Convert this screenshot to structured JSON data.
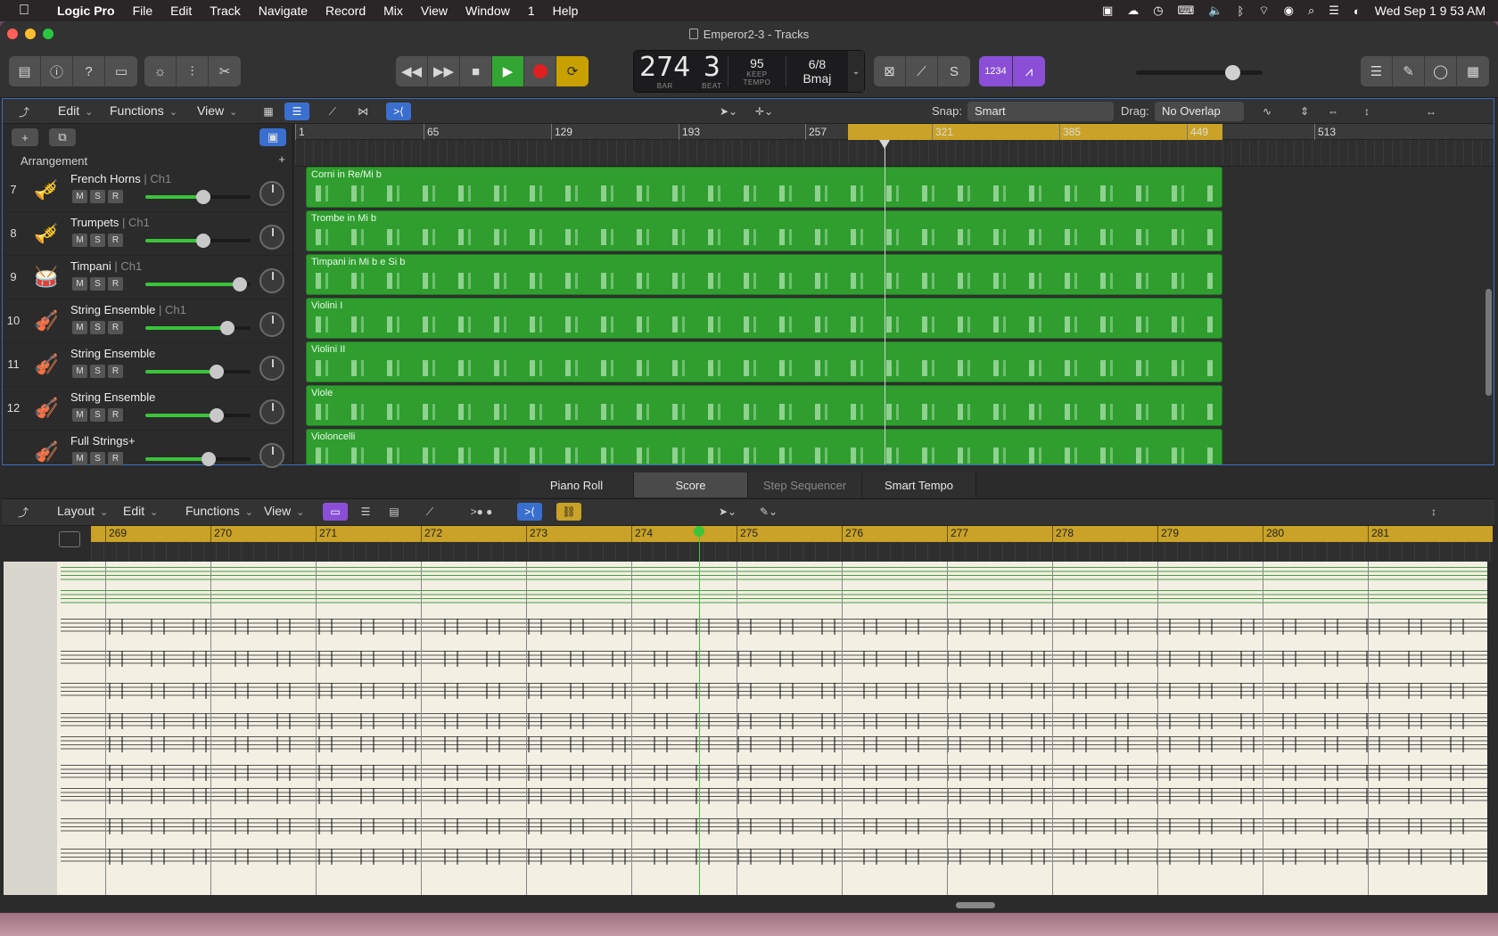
{
  "menubar": {
    "apple_icon": "apple-icon",
    "app_name": "Logic Pro",
    "items": [
      "File",
      "Edit",
      "Track",
      "Navigate",
      "Record",
      "Mix",
      "View",
      "Window",
      "1",
      "Help"
    ],
    "clock": "Wed Sep 1  9 53 AM"
  },
  "window": {
    "title": "Emperor2-3 - Tracks"
  },
  "transport": {
    "bar": "274",
    "beat": "3",
    "bar_label": "BAR",
    "beat_label": "BEAT",
    "tempo": "95",
    "tempo_mode": "KEEP",
    "tempo_label": "TEMPO",
    "signature": "6/8",
    "key": "Bmaj",
    "count_in": "1234"
  },
  "tracks_bar": {
    "edit": "Edit",
    "functions": "Functions",
    "view": "View",
    "snap_label": "Snap:",
    "snap_value": "Smart",
    "drag_label": "Drag:",
    "drag_value": "No Overlap",
    "arrangement": "Arrangement"
  },
  "ruler": {
    "marks": [
      "1",
      "65",
      "129",
      "193",
      "257",
      "321",
      "385",
      "449",
      "513"
    ]
  },
  "tracks": [
    {
      "num": "7",
      "name": "French Horns",
      "ch": " | Ch1",
      "region": "Corni in Re/Mi b",
      "volume": 0.55
    },
    {
      "num": "8",
      "name": "Trumpets",
      "ch": " | Ch1",
      "region": "Trombe in Mi b",
      "volume": 0.55
    },
    {
      "num": "9",
      "name": "Timpani",
      "ch": " | Ch1",
      "region": "Timpani in Mi b e Si b",
      "volume": 0.9
    },
    {
      "num": "10",
      "name": "String Ensemble",
      "ch": " | Ch1",
      "region": "Violini I",
      "volume": 0.78
    },
    {
      "num": "11",
      "name": "String Ensemble",
      "ch": "",
      "region": "Violini II",
      "volume": 0.68
    },
    {
      "num": "12",
      "name": "String Ensemble",
      "ch": "",
      "region": "Viole",
      "volume": 0.68
    },
    {
      "num": "",
      "name": "Full Strings+",
      "ch": "",
      "region": "Violoncelli",
      "volume": 0.6
    }
  ],
  "editor": {
    "tabs": [
      "Piano Roll",
      "Score",
      "Step Sequencer",
      "Smart Tempo"
    ],
    "layout": "Layout",
    "edit": "Edit",
    "functions": "Functions",
    "view": "View"
  },
  "score_ruler": {
    "marks": [
      "269",
      "270",
      "271",
      "272",
      "273",
      "274",
      "275",
      "276",
      "277",
      "278",
      "279",
      "280",
      "281"
    ]
  },
  "colors": {
    "region_green": "#2f9e2f",
    "cycle_yellow": "#c9a227",
    "play_green": "#33a532",
    "record_red": "#e02020",
    "accent_purple": "#8a4fd6",
    "selection_blue": "#3a6fd0"
  }
}
